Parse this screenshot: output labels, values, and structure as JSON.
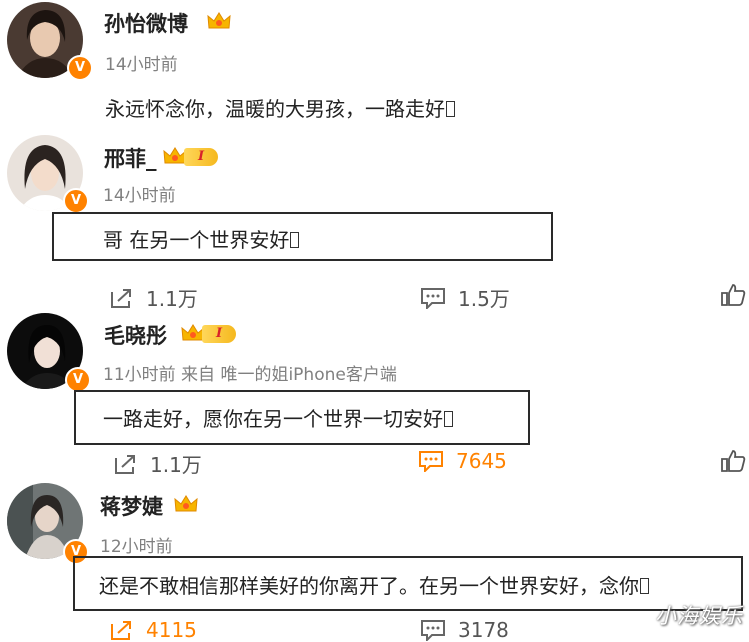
{
  "comments": [
    {
      "name": "孙怡微博",
      "time": "14小时前",
      "content": "永远怀念你，温暖的大男孩，一路走好",
      "verified": "V"
    },
    {
      "name": "邢菲_",
      "level": "I",
      "time": "14小时前",
      "content": "哥 在另一个世界安好",
      "verified": "V",
      "forwards": "1.1万",
      "replies": "1.5万"
    },
    {
      "name": "毛晓彤",
      "level": "I",
      "time": "11小时前 来自 唯一的姐iPhone客户端",
      "content": "一路走好，愿你在另一个世界一切安好",
      "verified": "V",
      "forwards": "1.1万",
      "replies": "7645"
    },
    {
      "name": "蒋梦婕",
      "time": "12小时前",
      "content": "还是不敢相信那样美好的你离开了。在另一个世界安好，念你",
      "verified": "V",
      "forwards": "4115",
      "replies": "3178"
    }
  ],
  "watermark": "小海娱乐",
  "colors": {
    "accent": "#ff8200",
    "text": "#222222",
    "meta": "#808080"
  }
}
